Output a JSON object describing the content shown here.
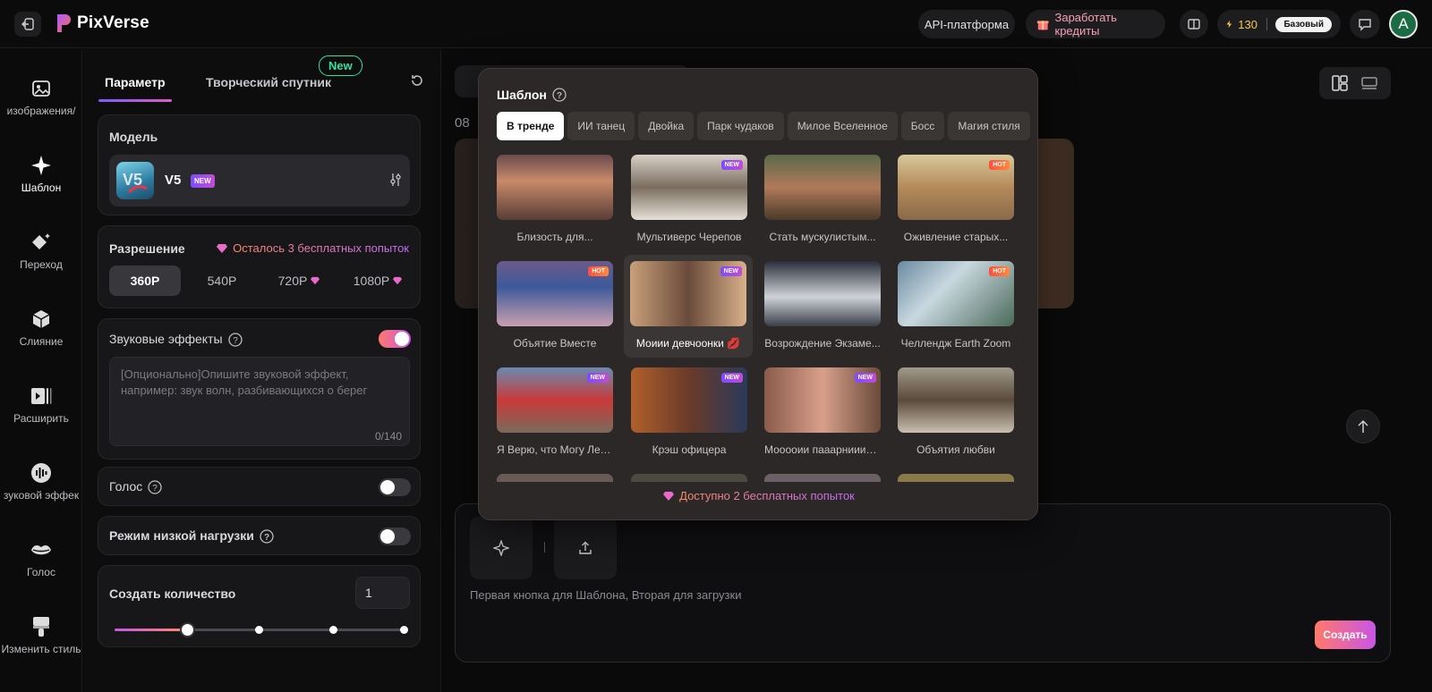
{
  "app": {
    "name": "PixVerse"
  },
  "topbar": {
    "api_label": "API-платформа",
    "earn_label": "Заработать кредиты",
    "energy": "130",
    "plan": "Базовый",
    "avatar_letter": "A"
  },
  "nav": [
    {
      "label": "изображения/",
      "icon": "image-icon"
    },
    {
      "label": "Шаблон",
      "icon": "sparkle-icon"
    },
    {
      "label": "Переход",
      "icon": "transition-icon"
    },
    {
      "label": "Слияние",
      "icon": "cube-icon"
    },
    {
      "label": "Расширить",
      "icon": "extend-icon"
    },
    {
      "label": "зуковой эффек",
      "icon": "sound-wave-icon"
    },
    {
      "label": "Голос",
      "icon": "lips-icon"
    },
    {
      "label": "Изменить стиль",
      "icon": "brush-icon"
    }
  ],
  "panel": {
    "tabs": {
      "param": "Параметр",
      "creative": "Творческий спутник",
      "new_badge": "New"
    },
    "model": {
      "title": "Модель",
      "name": "V5",
      "badge": "NEW"
    },
    "resolution": {
      "title": "Разрешение",
      "free": "Осталось 3 бесплатных попыток",
      "options": [
        "360P",
        "540P",
        "720P",
        "1080P"
      ],
      "selected": "360P"
    },
    "sound": {
      "title": "Звуковые эффекты",
      "enabled": true,
      "placeholder": "[Опционально]Опишите звуковой эффект, например: звук волн, разбивающихся о берег",
      "counter": "0/140"
    },
    "voice": {
      "title": "Голос",
      "enabled": false
    },
    "lowload": {
      "title": "Режим низкой нагрузки",
      "enabled": false
    },
    "quantity": {
      "title": "Создать количество",
      "value": "1",
      "slider_position": 0.25
    }
  },
  "main": {
    "date_fragment": "08",
    "prompt_hint": "Первая кнопка для Шаблона, Вторая для загрузки",
    "create_label": "Создать"
  },
  "template_popover": {
    "title": "Шаблон",
    "categories": [
      "В тренде",
      "ИИ танец",
      "Двойка",
      "Парк чудаков",
      "Милое Вселенное",
      "Босс",
      "Магия стиля"
    ],
    "active_category": "В тренде",
    "tiles": [
      {
        "label": "Близость для...",
        "badge": ""
      },
      {
        "label": "Мультиверс Черепов",
        "badge": "NEW"
      },
      {
        "label": "Стать мускулистым...",
        "badge": ""
      },
      {
        "label": "Оживление старых...",
        "badge": "HOT"
      },
      {
        "label": "Объятие Вместе",
        "badge": "HOT"
      },
      {
        "label": "Моиии девчоонки 💋",
        "badge": "NEW"
      },
      {
        "label": "Возрождение Экзаме...",
        "badge": ""
      },
      {
        "label": "Челлендж Earth Zoom",
        "badge": "HOT"
      },
      {
        "label": "Я Верю, что Могу Летать",
        "badge": "NEW"
      },
      {
        "label": "Крэш офицера",
        "badge": "NEW"
      },
      {
        "label": "Мооооии пааарнииии...",
        "badge": "NEW"
      },
      {
        "label": "Объятия любви",
        "badge": ""
      }
    ],
    "footer": "Доступно 2 бесплатных попыток"
  },
  "colors": {
    "accent_gradient_start": "#ff7a6a",
    "accent_gradient_end": "#c955e6",
    "new_green": "#36e0a0"
  }
}
